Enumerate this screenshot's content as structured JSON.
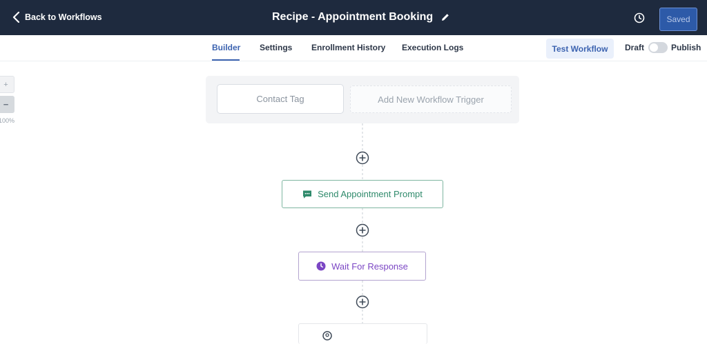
{
  "header": {
    "back_label": "Back to Workflows",
    "title": "Recipe - Appointment Booking",
    "saved_label": "Saved"
  },
  "tabs": [
    {
      "label": "Builder",
      "active": true
    },
    {
      "label": "Settings",
      "active": false
    },
    {
      "label": "Enrollment History",
      "active": false
    },
    {
      "label": "Execution Logs",
      "active": false
    }
  ],
  "toolbar": {
    "test_workflow_label": "Test Workflow",
    "draft_label": "Draft",
    "publish_label": "Publish",
    "publish_enabled": false
  },
  "zoom": {
    "in_label": "+",
    "out_label": "−",
    "level": "100%"
  },
  "trigger_panel": {
    "trigger_label": "Contact Tag",
    "add_trigger_label": "Add New Workflow Trigger"
  },
  "nodes": [
    {
      "label": "Send Appointment Prompt",
      "icon": "chat-message-icon",
      "color": "#2f8a6b"
    },
    {
      "label": "Wait For Response",
      "icon": "clock-icon",
      "color": "#7b46c4"
    }
  ],
  "colors": {
    "header_bg": "#1e2a3e",
    "accent": "#3c63b0",
    "action_green": "#2f8a6b",
    "wait_purple": "#7b46c4"
  }
}
